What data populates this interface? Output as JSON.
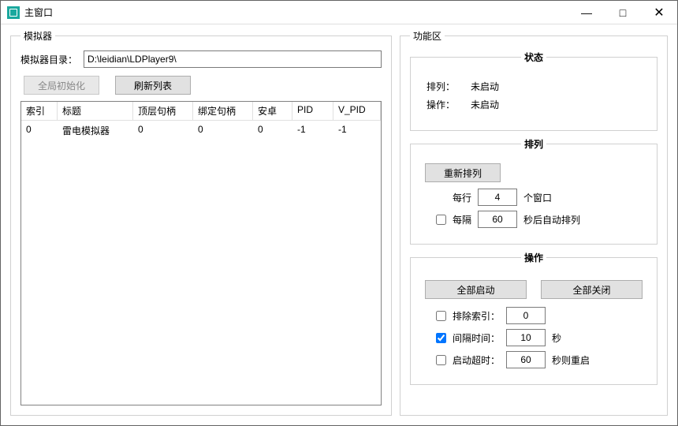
{
  "window": {
    "title": "主窗口",
    "controls": {
      "min": "—",
      "max": "□",
      "close": "✕"
    }
  },
  "emulator": {
    "legend": "模拟器",
    "dir_label": "模拟器目录：",
    "dir_value": "D:\\leidian\\LDPlayer9\\",
    "btn_global_init": "全局初始化",
    "btn_refresh": "刷新列表",
    "columns": [
      "索引",
      "标题",
      "顶层句柄",
      "绑定句柄",
      "安卓",
      "PID",
      "V_PID"
    ],
    "rows": [
      {
        "index": "0",
        "title": "雷电模拟器",
        "top_hwnd": "0",
        "bind_hwnd": "0",
        "android": "0",
        "pid": "-1",
        "vpid": "-1"
      }
    ]
  },
  "func": {
    "legend": "功能区",
    "status": {
      "legend": "状态",
      "arrange_label": "排列：",
      "arrange_value": "未启动",
      "operate_label": "操作：",
      "operate_value": "未启动"
    },
    "arrange": {
      "legend": "排列",
      "btn_rearrange": "重新排列",
      "perrow_label": "每行",
      "perrow_value": "4",
      "perrow_suffix": "个窗口",
      "interval_check": false,
      "interval_label": "每隔",
      "interval_value": "60",
      "interval_suffix": "秒后自动排列"
    },
    "ops": {
      "legend": "操作",
      "btn_start_all": "全部启动",
      "btn_close_all": "全部关闭",
      "exclude_check": false,
      "exclude_label": "排除索引：",
      "exclude_value": "0",
      "interval_check": true,
      "interval_label": "间隔时间：",
      "interval_value": "10",
      "interval_suffix": "秒",
      "timeout_check": false,
      "timeout_label": "启动超时：",
      "timeout_value": "60",
      "timeout_suffix": "秒则重启"
    }
  }
}
